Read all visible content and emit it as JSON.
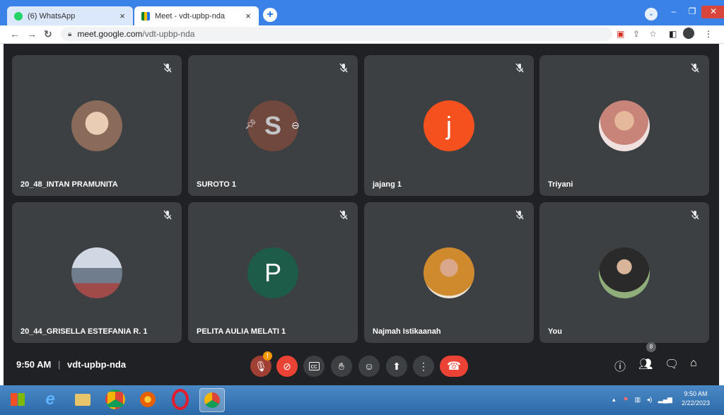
{
  "browser": {
    "tabs": [
      {
        "label": "(6) WhatsApp",
        "close": "×"
      },
      {
        "label": "Meet - vdt-upbp-nda",
        "close": "×"
      }
    ],
    "new_tab": "+",
    "window_controls": {
      "minimize": "–",
      "restore": "❐",
      "close": "✕"
    },
    "url_host": "meet.google.com",
    "url_path": "/vdt-upbp-nda"
  },
  "participants": [
    {
      "name": "20_48_INTAN PRAMUNITA",
      "avatar_type": "photo",
      "avatar_color": "#8a6a58"
    },
    {
      "name": "SUROTO 1",
      "avatar_type": "letter",
      "letter": "S",
      "avatar_color": "#7a4a3d"
    },
    {
      "name": "jajang 1",
      "avatar_type": "letter",
      "letter": "j",
      "avatar_color": "#f4511e"
    },
    {
      "name": "Triyani",
      "avatar_type": "photo",
      "avatar_color": "#c9847a"
    },
    {
      "name": "20_44_GRISELLA ESTEFANIA R. 1",
      "avatar_type": "photo",
      "avatar_color": "#6f7d8c"
    },
    {
      "name": "PELITA AULIA MELATI 1",
      "avatar_type": "letter",
      "letter": "P",
      "avatar_color": "#1e5c4a"
    },
    {
      "name": "Najmah Istikaanah",
      "avatar_type": "photo",
      "avatar_color": "#d08a2e"
    },
    {
      "name": "You",
      "avatar_type": "photo",
      "avatar_color": "#3a3a3a"
    }
  ],
  "meeting": {
    "time": "9:50 AM",
    "separator": "|",
    "code": "vdt-upbp-nda",
    "people_count": "8",
    "mic_warning": "!"
  },
  "colors": {
    "accent": "#1a73e8",
    "hangup": "#ea4335",
    "tile_bg": "#3c4043",
    "meet_bg": "#202124"
  },
  "taskbar": {
    "clock_time": "9:50 AM",
    "clock_date": "2/22/2023"
  }
}
